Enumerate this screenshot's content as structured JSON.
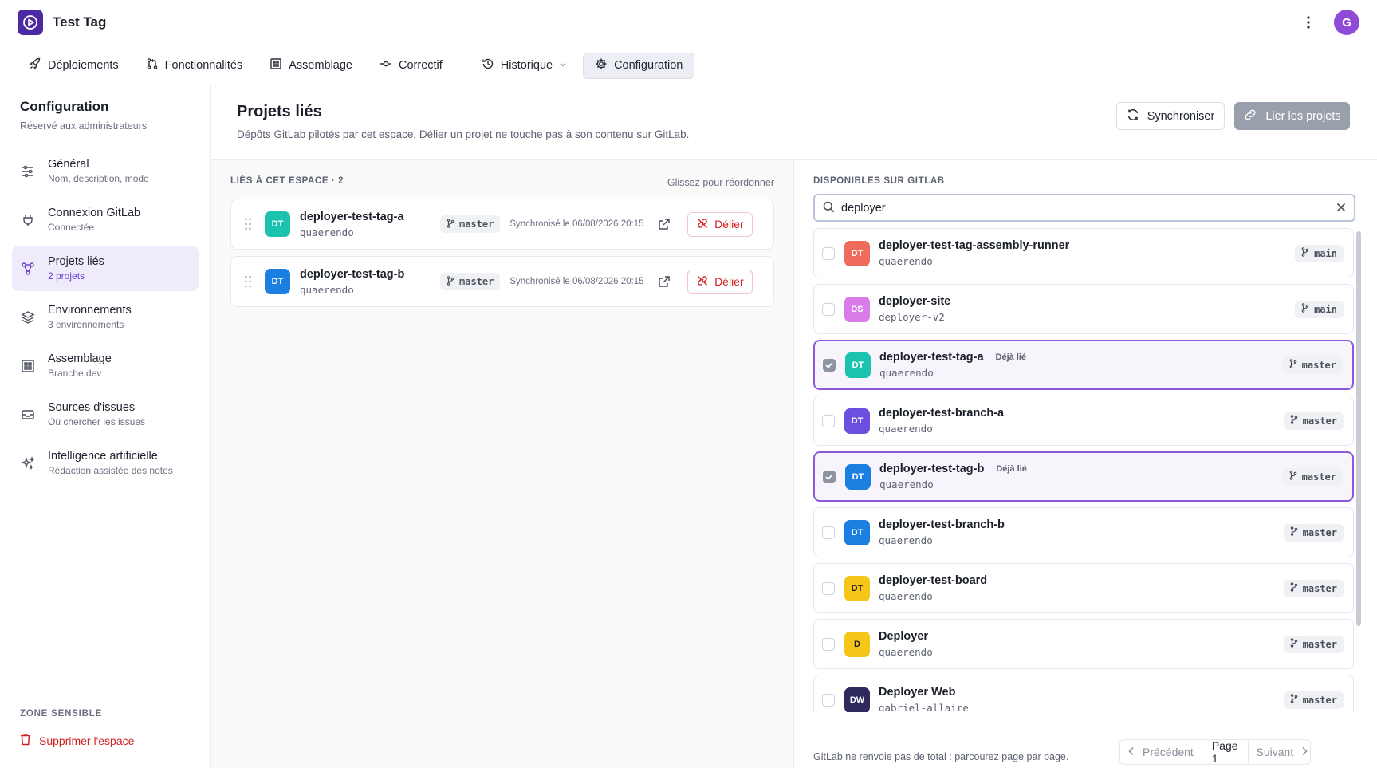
{
  "app": {
    "title": "Test Tag",
    "avatar_initial": "G",
    "brand_color": "#4b2aa3",
    "accent_color": "#8b5ad7",
    "danger_color": "#d02222"
  },
  "nav": {
    "items": [
      {
        "label": "Déploiements",
        "icon": "rocket-icon"
      },
      {
        "label": "Fonctionnalités",
        "icon": "git-pull-request-icon"
      },
      {
        "label": "Assemblage",
        "icon": "assembly-icon"
      },
      {
        "label": "Correctif",
        "icon": "git-commit-icon"
      },
      {
        "label": "Historique",
        "icon": "history-icon"
      },
      {
        "label": "Configuration",
        "icon": "gear-icon",
        "active": true
      }
    ]
  },
  "sidebar": {
    "title": "Configuration",
    "subtitle": "Réservé aux administrateurs",
    "items": [
      {
        "label": "Général",
        "desc": "Nom, description, mode",
        "icon": "sliders-icon"
      },
      {
        "label": "Connexion GitLab",
        "desc": "Connectée",
        "icon": "plug-icon"
      },
      {
        "label": "Projets liés",
        "desc": "2 projets",
        "icon": "linked-nodes-icon",
        "active": true
      },
      {
        "label": "Environnements",
        "desc": "3 environnements",
        "icon": "layers-icon"
      },
      {
        "label": "Assemblage",
        "desc": "Branche dev",
        "icon": "assembly-icon"
      },
      {
        "label": "Sources d'issues",
        "desc": "Où chercher les issues",
        "icon": "inbox-icon"
      },
      {
        "label": "Intelligence artificielle",
        "desc": "Rédaction assistée des notes",
        "icon": "sparkles-icon"
      }
    ],
    "danger_title": "ZONE SENSIBLE",
    "danger_action": "Supprimer l'espace"
  },
  "page": {
    "title": "Projets liés",
    "subtitle": "Dépôts GitLab pilotés par cet espace. Délier un projet ne touche pas à son contenu sur GitLab.",
    "sync_label": "Synchroniser",
    "link_label": "Lier les projets"
  },
  "linked": {
    "header": "LIÉS À CET ESPACE · 2",
    "hint": "Glissez pour réordonner",
    "unlink_label": "Délier",
    "items": [
      {
        "initials": "DT",
        "color": "#1bc2b0",
        "name": "deployer-test-tag-a",
        "namespace": "quaerendo",
        "branch": "master",
        "synced": "Synchronisé le 06/08/2026 20:15"
      },
      {
        "initials": "DT",
        "color": "#1a7fe0",
        "name": "deployer-test-tag-b",
        "namespace": "quaerendo",
        "branch": "master",
        "synced": "Synchronisé le 06/08/2026 20:15"
      }
    ]
  },
  "available": {
    "header": "DISPONIBLES SUR GITLAB",
    "search_value": "deployer",
    "already_label": "Déjà lié",
    "items": [
      {
        "initials": "DT",
        "color": "#ef6b5b",
        "name": "deployer-test-tag-assembly-runner",
        "namespace": "quaerendo",
        "branch": "main",
        "selected": false,
        "already": false
      },
      {
        "initials": "DS",
        "color": "#d97be8",
        "name": "deployer-site",
        "namespace": "deployer-v2",
        "branch": "main",
        "selected": false,
        "already": false
      },
      {
        "initials": "DT",
        "color": "#1bc2b0",
        "name": "deployer-test-tag-a",
        "namespace": "quaerendo",
        "branch": "master",
        "selected": true,
        "already": true
      },
      {
        "initials": "DT",
        "color": "#6d4fe0",
        "name": "deployer-test-branch-a",
        "namespace": "quaerendo",
        "branch": "master",
        "selected": false,
        "already": false
      },
      {
        "initials": "DT",
        "color": "#1a7fe0",
        "name": "deployer-test-tag-b",
        "namespace": "quaerendo",
        "branch": "master",
        "selected": true,
        "already": true
      },
      {
        "initials": "DT",
        "color": "#1a7fe0",
        "name": "deployer-test-branch-b",
        "namespace": "quaerendo",
        "branch": "master",
        "selected": false,
        "already": false
      },
      {
        "initials": "DT",
        "color": "#f5c518",
        "name": "deployer-test-board",
        "namespace": "quaerendo",
        "branch": "master",
        "selected": false,
        "already": false
      },
      {
        "initials": "D",
        "color": "#f5c518",
        "name": "Deployer",
        "namespace": "quaerendo",
        "branch": "master",
        "selected": false,
        "already": false
      },
      {
        "initials": "DW",
        "color": "#2e2a5e",
        "name": "Deployer Web",
        "namespace": "gabriel-allaire",
        "branch": "master",
        "selected": false,
        "already": false
      }
    ],
    "footnote": "GitLab ne renvoie pas de total : parcourez page par page.",
    "prev_label": "Précédent",
    "page_label": "Page 1",
    "next_label": "Suivant"
  }
}
